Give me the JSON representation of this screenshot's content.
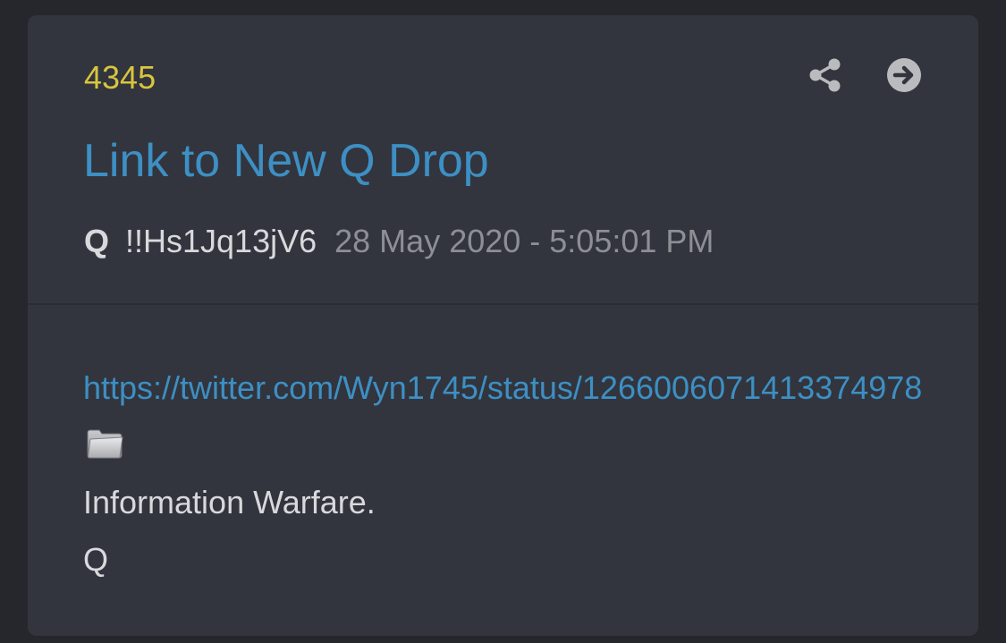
{
  "post": {
    "number": "4345",
    "title": "Link to New Q Drop",
    "author": "Q",
    "tripcode": "!!Hs1Jq13jV6",
    "timestamp": "28 May 2020 - 5:05:01 PM",
    "link": "https://twitter.com/Wyn1745/status/1266006071413374978",
    "lines": [
      "Information Warfare.",
      "Q"
    ]
  },
  "icons": {
    "share": "share-icon",
    "open": "arrow-right-circle-icon",
    "attachment": "folder-icon"
  },
  "colors": {
    "background": "#25272d",
    "card": "#32353d",
    "post_number": "#d9c53f",
    "link": "#3d8fc4",
    "text": "#d8d9dc",
    "muted": "#8d8f95",
    "icon": "#b9bbbf"
  }
}
